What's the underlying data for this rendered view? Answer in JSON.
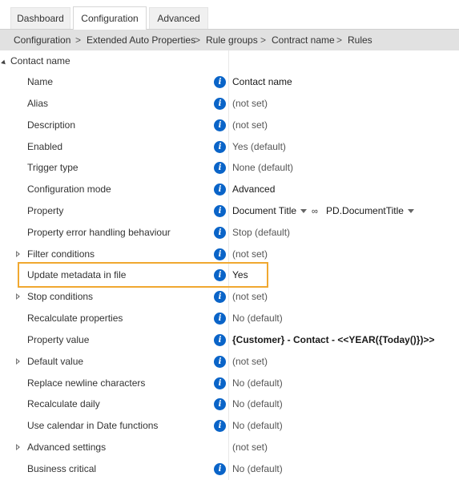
{
  "tabs": [
    {
      "label": "Dashboard"
    },
    {
      "label": "Configuration"
    },
    {
      "label": "Advanced"
    }
  ],
  "breadcrumb": [
    "Configuration",
    "Extended Auto Properties",
    "Rule groups",
    "Contract name",
    "Rules"
  ],
  "breadcrumb_separator": ">",
  "tree": {
    "root_label": "Contact name",
    "rows": [
      {
        "label": "Name",
        "value": "Contact name"
      },
      {
        "label": "Alias",
        "value": "(not set)"
      },
      {
        "label": "Description",
        "value": "(not set)"
      },
      {
        "label": "Enabled",
        "value": "Yes (default)"
      },
      {
        "label": "Trigger type",
        "value": "None (default)"
      },
      {
        "label": "Configuration mode",
        "value": "Advanced"
      },
      {
        "label": "Property",
        "value": "Document Title",
        "value2": "PD.DocumentTitle"
      },
      {
        "label": "Property error handling behaviour",
        "value": "Stop (default)"
      },
      {
        "label": "Filter conditions",
        "value": "(not set)"
      },
      {
        "label": "Update metadata in file",
        "value": "Yes"
      },
      {
        "label": "Stop conditions",
        "value": "(not set)"
      },
      {
        "label": "Recalculate properties",
        "value": "No (default)"
      },
      {
        "label": "Property value",
        "value": "{Customer} - Contact - <<YEAR({Today()})>>"
      },
      {
        "label": "Default value",
        "value": "(not set)"
      },
      {
        "label": "Replace newline characters",
        "value": "No (default)"
      },
      {
        "label": "Recalculate daily",
        "value": "No (default)"
      },
      {
        "label": "Use calendar in Date functions",
        "value": "No (default)"
      },
      {
        "label": "Advanced settings",
        "value": "(not set)"
      },
      {
        "label": "Business critical",
        "value": "No (default)"
      }
    ]
  },
  "icons": {
    "info": "info-icon",
    "link": "link-icon",
    "expand": "expand-arrow-icon",
    "dropdown": "dropdown-arrow-icon"
  },
  "colors": {
    "info_icon": "#0a64c8",
    "highlight": "#f0a830",
    "breadcrumb_bg": "#e1e1e1"
  }
}
